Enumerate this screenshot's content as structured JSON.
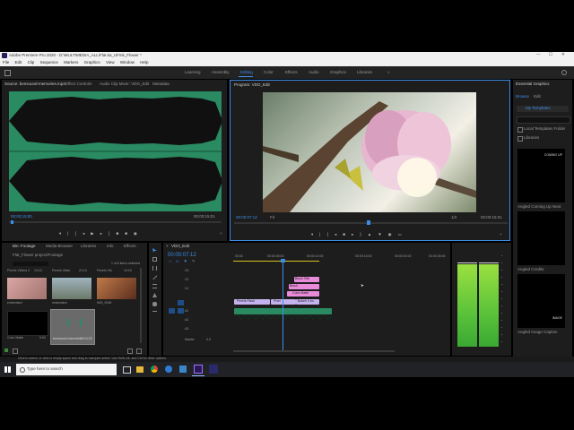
{
  "window": {
    "title": "Adobe Premiere Pro 2020 - D:\\MULTIMEDIA_ALL\\Flat.ka_UFink_Flower *"
  },
  "menu": [
    "File",
    "Edit",
    "Clip",
    "Sequence",
    "Markers",
    "Graphics",
    "View",
    "Window",
    "Help"
  ],
  "workspaces": [
    "Learning",
    "Assembly",
    "Editing",
    "Color",
    "Effects",
    "Audio",
    "Graphics",
    "Libraries"
  ],
  "workspace_active": "Editing",
  "source": {
    "tabs": [
      "Source: bensound-memories.mp3",
      "Effect Controls",
      "Audio Clip Mixer: VDO_Edit",
      "Metadata"
    ],
    "timecode_left": "00;00;15;00",
    "timecode_right": "00;00;15;01"
  },
  "program": {
    "tab": "Program: VDO_Edit",
    "timecode_left": "00:00:07:12",
    "fit": "Fit",
    "zoom": "1/2",
    "timecode_right": "00:00:15:01"
  },
  "project": {
    "tabs": [
      "Bin: Footage",
      "Media Browser",
      "Libraries",
      "Info",
      "Effects"
    ],
    "path": "Flat_Flower project/Footage",
    "count": "1 of 6 items selected",
    "items": [
      {
        "name": "Pexels Videos 2",
        "dur": "13:13",
        "color": "#b98a88"
      },
      {
        "name": "Pexels Video",
        "dur": "21:13",
        "color": "#7a8a8a"
      },
      {
        "name": "Pexels Vid.",
        "dur": "10:10",
        "color": "#8a5a3a"
      },
      {
        "name": "Color Matte",
        "dur": "5:00",
        "color": "#000000"
      },
      {
        "name": "bensound-memories",
        "dur": "15:24:23",
        "color": "#6a6a6a"
      }
    ],
    "extra_labels": [
      "embedded",
      "embedded",
      "IMG_0006"
    ]
  },
  "timeline": {
    "tab": "VDO_Edit",
    "timecode": "00:00:07:12",
    "ruler": [
      "00:00",
      "00:00:05:00",
      "00:00:10:00",
      "00:00:15:00",
      "00:00:20:00",
      "00:00:25:00"
    ],
    "tracks": [
      "V3",
      "V2",
      "V1",
      "A1",
      "A2",
      "A3",
      "Master"
    ],
    "master_value": "0.0",
    "clips": [
      {
        "label": "Blush Title",
        "color": "#e98bd9"
      },
      {
        "label": "Blush",
        "color": "#e98bd9"
      },
      {
        "label": "Color Matte",
        "color": "#e98bd9"
      },
      {
        "label": "Pexels Flash ",
        "color": "#c5b3f0"
      },
      {
        "label": "Pixel",
        "color": "#c5b3f0"
      },
      {
        "label": "Bokeh 4 bo",
        "color": "#c5b3f0"
      }
    ]
  },
  "graphics": {
    "title": "Essential Graphics",
    "tabs": [
      "Browse",
      "Edit"
    ],
    "folder": "My Templates",
    "checkbox1": "Local Templates Folder",
    "checkbox2": "Libraries",
    "templates": [
      {
        "name": "Angled Coming Up Next",
        "text": "COMING UP"
      },
      {
        "name": "Angled Credits",
        "text": ""
      },
      {
        "name": "Angled Image Caption",
        "text": "IMAGE"
      }
    ]
  },
  "status": "Click to select, or click in empty space and drag to marquee select. Use Shift, Alt, and Ctrl for other options.",
  "taskbar": {
    "search_placeholder": "Type here to search"
  }
}
